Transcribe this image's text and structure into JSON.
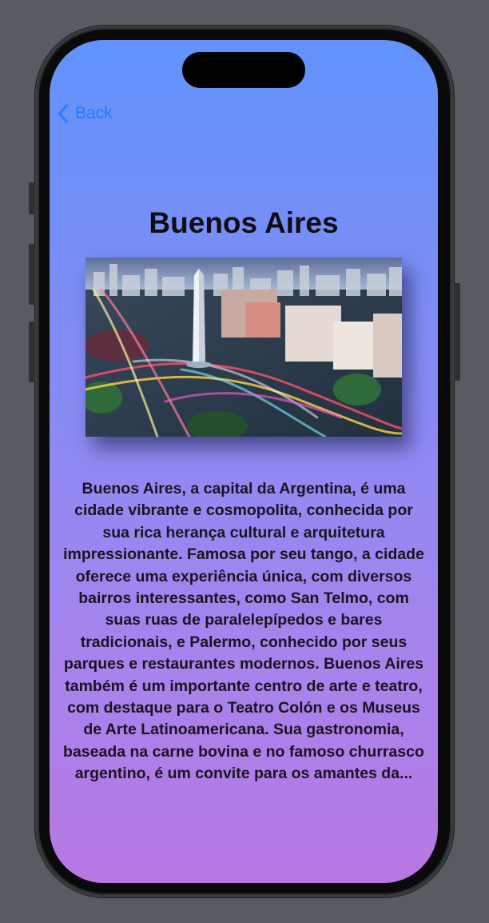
{
  "nav": {
    "back_label": "Back"
  },
  "city": {
    "title": "Buenos Aires",
    "image_alt": "Obelisco de Buenos Aires",
    "description": "Buenos Aires, a capital da Argentina, é uma cidade vibrante e cosmopolita, conhecida por sua rica herança cultural e arquitetura impressionante. Famosa por seu tango, a cidade oferece uma experiência única, com diversos bairros interessantes, como San Telmo, com suas ruas de paralelepípedos e bares tradicionais, e Palermo, conhecido por seus parques e restaurantes modernos. Buenos Aires também é um importante centro de arte e teatro, com destaque para o Teatro Colón e os Museus de Arte Latinoamericana. Sua gastronomia, baseada na carne bovina e no famoso churrasco argentino, é um convite para os amantes da..."
  },
  "colors": {
    "gradient_top": "#6193fc",
    "gradient_bottom": "#b877e4",
    "accent": "#1f7cff",
    "text": "#1a1420"
  },
  "icons": {
    "back": "chevron-left-icon"
  }
}
